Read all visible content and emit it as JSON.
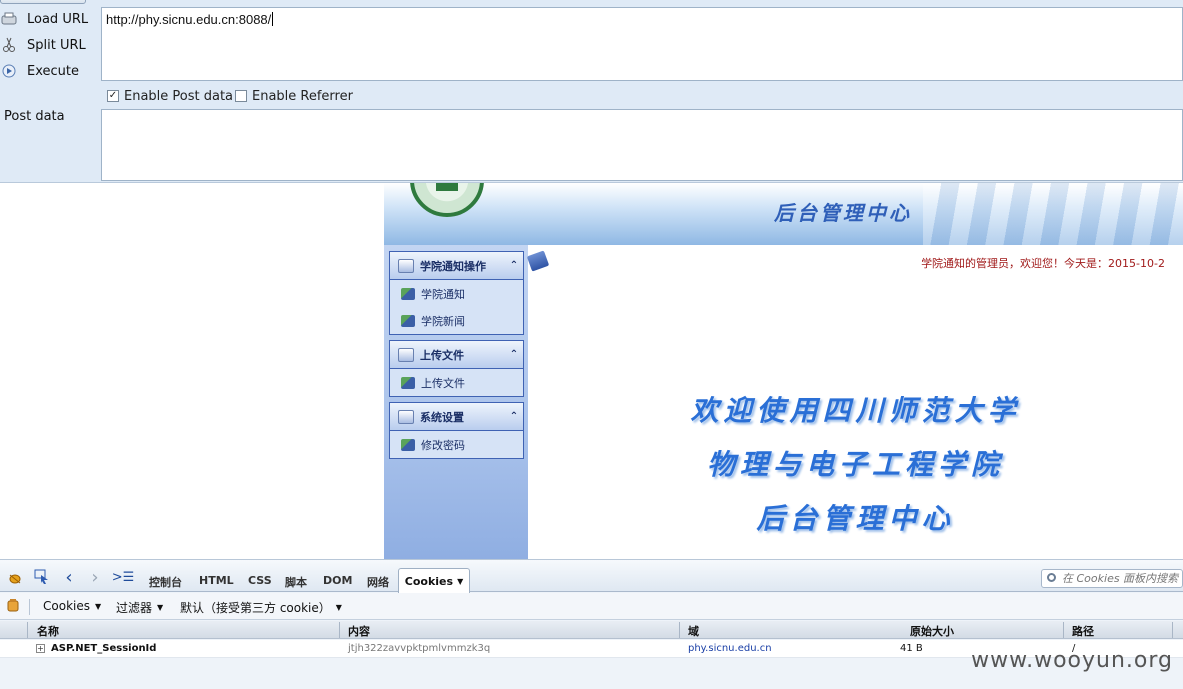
{
  "hackbar": {
    "actions": [
      {
        "label": "Load URL",
        "icon": "load-url-icon"
      },
      {
        "label": "Split URL",
        "icon": "scissors-icon"
      },
      {
        "label": "Execute",
        "icon": "play-icon"
      }
    ],
    "url_value": "http://phy.sicnu.edu.cn:8088/",
    "enable_post_label": "Enable Post data",
    "enable_post_checked": true,
    "enable_referrer_label": "Enable Referrer",
    "enable_referrer_checked": false,
    "post_data_label": "Post data",
    "post_data_value": ""
  },
  "webpage": {
    "banner_title": "后台管理中心",
    "nav_groups": [
      {
        "title": "学院通知操作",
        "items": [
          "学院通知",
          "学院新闻"
        ]
      },
      {
        "title": "上传文件",
        "items": [
          "上传文件"
        ]
      },
      {
        "title": "系统设置",
        "items": [
          "修改密码"
        ]
      }
    ],
    "welcome_text": "学院通知的管理员，欢迎您！今天是：2015-10-2",
    "heading_lines": [
      "欢迎使用四川师范大学",
      "物理与电子工程学院",
      "后台管理中心"
    ]
  },
  "firebug": {
    "tabs": [
      "控制台",
      "HTML",
      "CSS",
      "脚本",
      "DOM",
      "网络"
    ],
    "active_tab": "Cookies",
    "search_placeholder": "在 Cookies 面板内搜索",
    "subtoolbar": {
      "cookies_menu": "Cookies",
      "filter_menu": "过滤器",
      "default_menu": "默认（接受第三方 cookie）"
    },
    "columns": [
      "名称",
      "内容",
      "域",
      "原始大小",
      "路径"
    ],
    "rows": [
      {
        "name": "ASP.NET_SessionId",
        "content": "jtjh322zavvpktpmlvmmzk3q",
        "domain": "phy.sicnu.edu.cn",
        "size": "41 B",
        "path": "/"
      }
    ]
  },
  "watermark": "www.wooyun.org"
}
